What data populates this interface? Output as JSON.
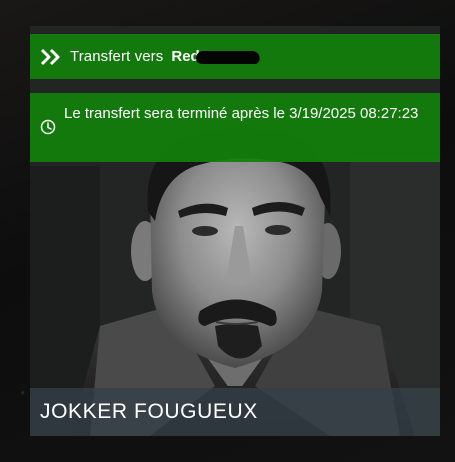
{
  "transfer_banner": {
    "icon": "double-chevron-right-icon",
    "label": "Transfert vers",
    "target_visible": "Red"
  },
  "timer_banner": {
    "icon": "clock-icon",
    "text": "Le transfert sera terminé après le 3/19/2025 08:27:23"
  },
  "character": {
    "name": "JOKKER FOUGUEUX"
  },
  "colors": {
    "banner_green": "#12800c",
    "name_bar": "#344048",
    "text": "#ffffff"
  }
}
